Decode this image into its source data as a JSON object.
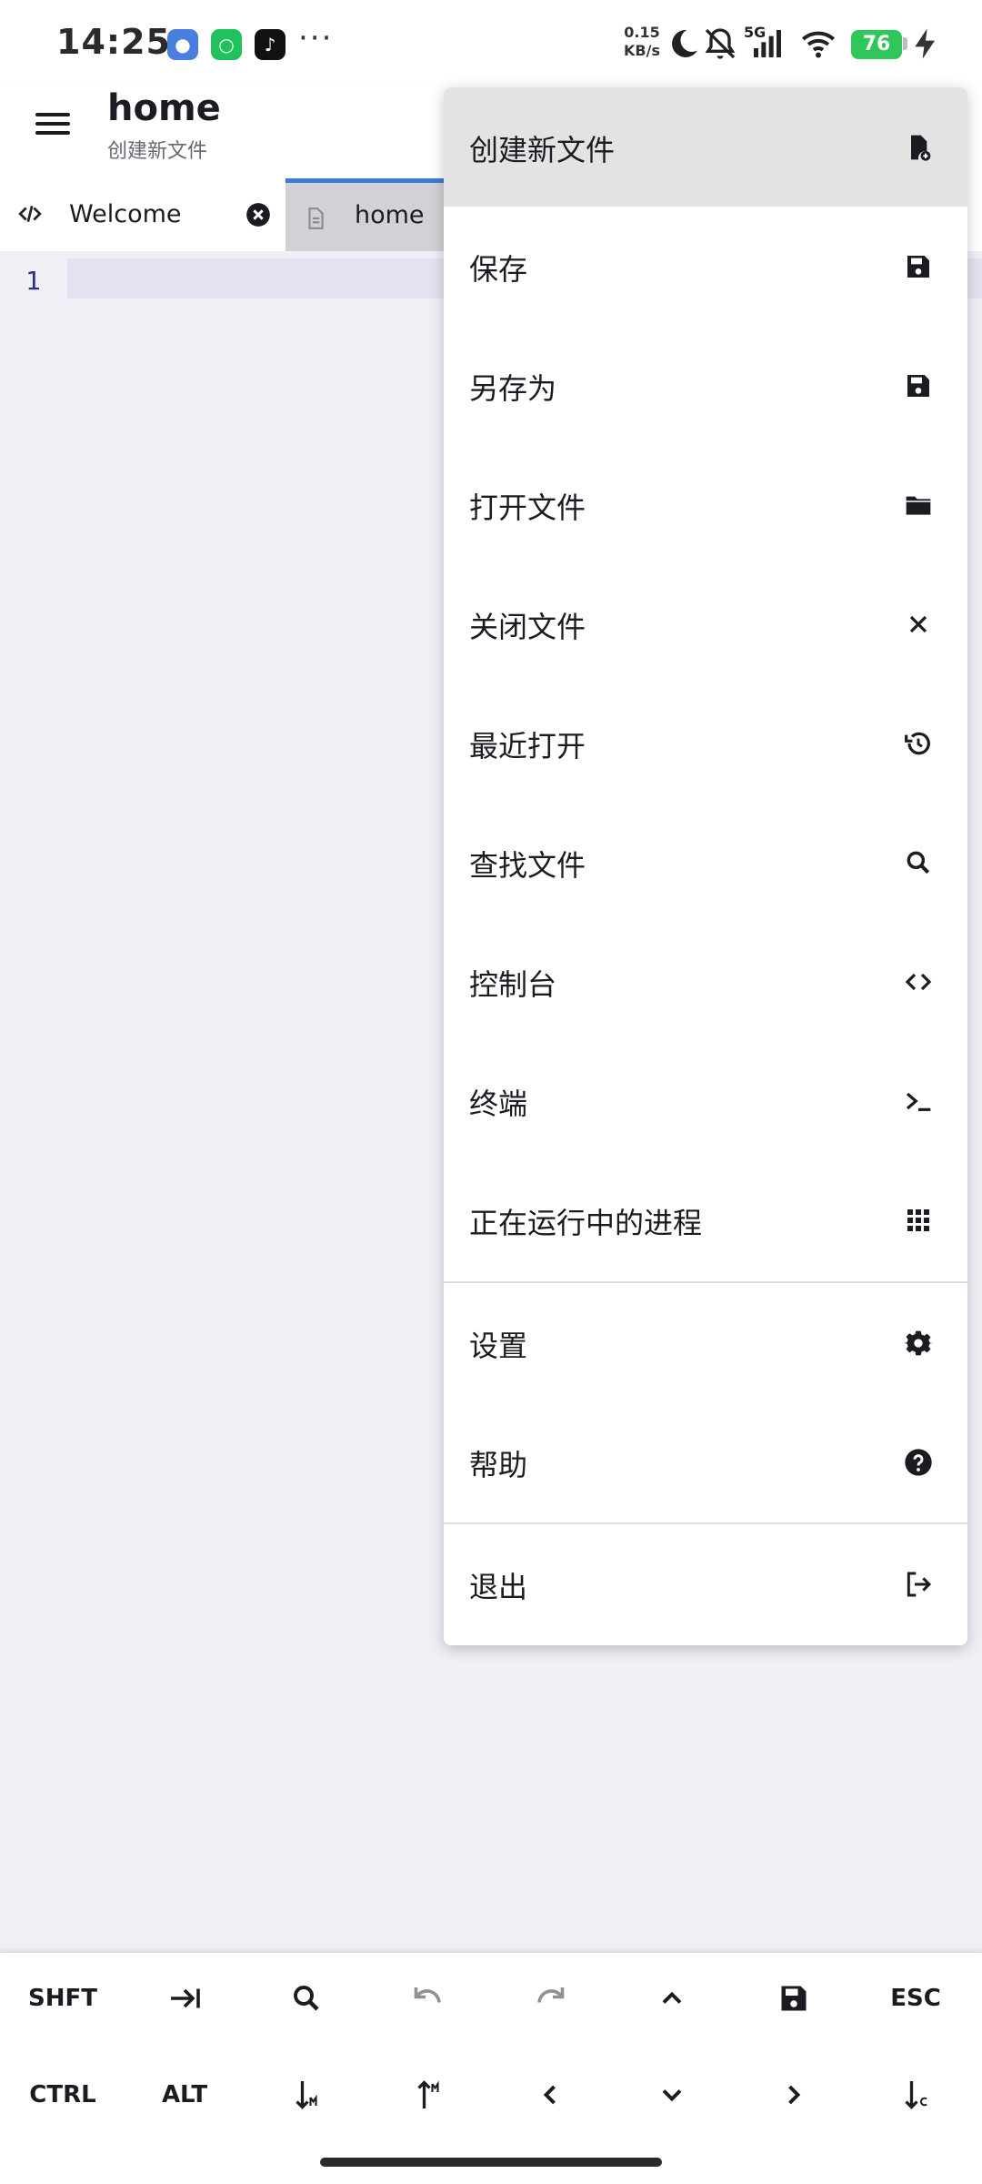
{
  "status_bar": {
    "time": "14:25",
    "net_speed_value": "0.15",
    "net_speed_unit": "KB/s",
    "network_type": "5G",
    "battery": "76",
    "more_dots": "···"
  },
  "app_bar": {
    "title": "home",
    "subtitle": "创建新文件"
  },
  "tabs": [
    {
      "label": "Welcome",
      "icon": "code-icon"
    },
    {
      "label": "home",
      "icon": "file-icon"
    }
  ],
  "editor": {
    "line_numbers": [
      "1"
    ]
  },
  "menu": {
    "items": [
      {
        "label": "创建新文件",
        "icon": "new-file-icon"
      },
      {
        "label": "保存",
        "icon": "save-icon"
      },
      {
        "label": "另存为",
        "icon": "save-as-icon"
      },
      {
        "label": "打开文件",
        "icon": "folder-icon"
      },
      {
        "label": "关闭文件",
        "icon": "close-icon"
      },
      {
        "label": "最近打开",
        "icon": "history-icon"
      },
      {
        "label": "查找文件",
        "icon": "search-icon"
      },
      {
        "label": "控制台",
        "icon": "code-brackets-icon"
      },
      {
        "label": "终端",
        "icon": "terminal-icon"
      },
      {
        "label": "正在运行中的进程",
        "icon": "grid-icon"
      },
      {
        "label": "设置",
        "icon": "gear-icon"
      },
      {
        "label": "帮助",
        "icon": "help-icon"
      },
      {
        "label": "退出",
        "icon": "exit-icon"
      }
    ]
  },
  "key_bar": {
    "row1": [
      {
        "label": "SHFT"
      },
      {
        "icon": "tab-key-icon"
      },
      {
        "icon": "search-icon"
      },
      {
        "icon": "undo-icon"
      },
      {
        "icon": "redo-icon"
      },
      {
        "icon": "arrow-up-icon"
      },
      {
        "icon": "save-icon"
      },
      {
        "label": "ESC"
      }
    ],
    "row2": [
      {
        "label": "CTRL"
      },
      {
        "label": "ALT"
      },
      {
        "icon": "move-down-icon"
      },
      {
        "icon": "move-up-icon"
      },
      {
        "icon": "arrow-left-icon"
      },
      {
        "icon": "arrow-down-icon"
      },
      {
        "icon": "arrow-right-icon"
      },
      {
        "icon": "copy-down-icon"
      }
    ]
  },
  "colors": {
    "accent": "#3c7bd7",
    "battery": "#2fc75a",
    "menu_highlight": "#e3e3e3",
    "editor_bg": "#f0eff5"
  }
}
